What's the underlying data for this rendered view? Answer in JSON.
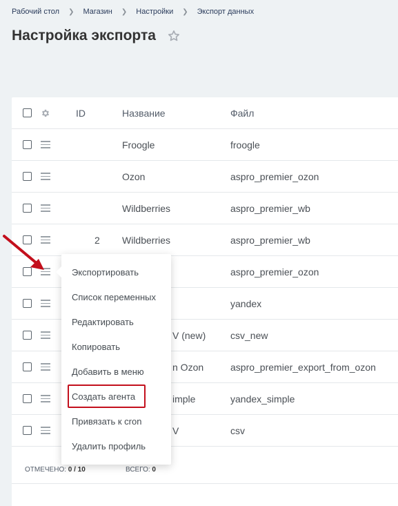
{
  "breadcrumb": [
    "Рабочий стол",
    "Магазин",
    "Настройки",
    "Экспорт данных"
  ],
  "page_title": "Настройка экспорта",
  "table": {
    "headers": {
      "id": "ID",
      "name": "Название",
      "file": "Файл"
    },
    "rows": [
      {
        "id": "",
        "name": "Froogle",
        "file": "froogle"
      },
      {
        "id": "",
        "name": "Ozon",
        "file": "aspro_premier_ozon"
      },
      {
        "id": "",
        "name": "Wildberries",
        "file": "aspro_premier_wb"
      },
      {
        "id": "2",
        "name": "Wildberries",
        "file": "aspro_premier_wb"
      },
      {
        "id": "",
        "name": "",
        "file": "aspro_premier_ozon"
      },
      {
        "id": "",
        "name": "",
        "file": "yandex"
      },
      {
        "id": "",
        "name": "V (new)",
        "file": "csv_new"
      },
      {
        "id": "",
        "name": "n Ozon",
        "file": "aspro_premier_export_from_ozon"
      },
      {
        "id": "",
        "name": "imple",
        "file": "yandex_simple"
      },
      {
        "id": "",
        "name": "V",
        "file": "csv"
      }
    ]
  },
  "footer": {
    "checked_label": "ОТМЕЧЕНО:",
    "checked_value": "0 / 10",
    "total_label": "ВСЕГО:",
    "total_value": "0"
  },
  "context_menu": {
    "items": [
      "Экспортировать",
      "Список переменных",
      "Редактировать",
      "Копировать",
      "Добавить в меню",
      "Создать агента",
      "Привязать к cron",
      "Удалить профиль"
    ],
    "highlighted_item": "Создать агента"
  },
  "colors": {
    "highlight": "#c30f1c",
    "arrow": "#c30f1c"
  },
  "icons": [
    "star-icon",
    "gear-icon",
    "hamburger-icon",
    "red-arrow-annotation"
  ]
}
